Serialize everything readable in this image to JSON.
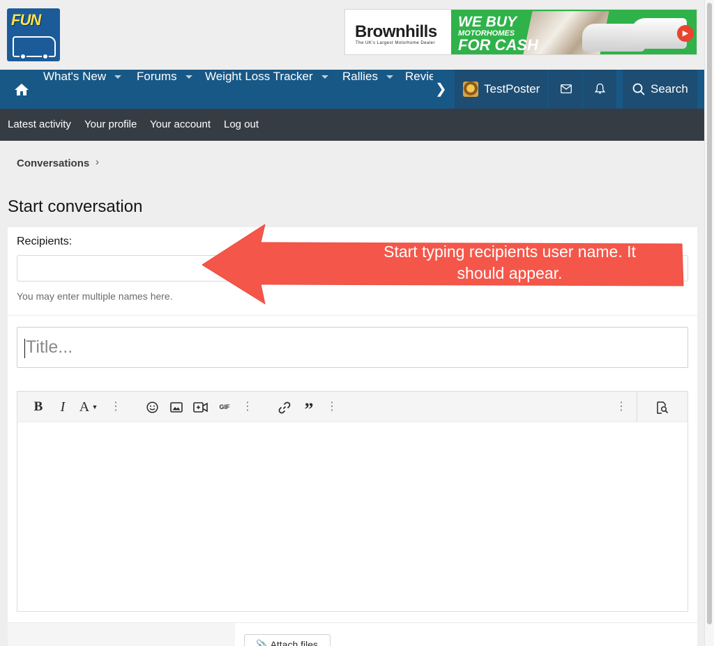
{
  "header": {
    "logo_text": "FUN",
    "banner": {
      "brand": "Brownhills",
      "tagline": "The UK's Largest Motorhome Dealer",
      "line1": "WE BUY",
      "line2": "MOTORHOMES",
      "line3": "FOR CASH"
    }
  },
  "nav": {
    "items": [
      {
        "label": "What's New"
      },
      {
        "label": "Forums"
      },
      {
        "label": "Weight Loss Tracker"
      },
      {
        "label": "Rallies"
      },
      {
        "label": "Revie"
      }
    ],
    "user": "TestPoster",
    "search_label": "Search"
  },
  "subnav": {
    "items": [
      {
        "label": "Latest activity"
      },
      {
        "label": "Your profile"
      },
      {
        "label": "Your account"
      },
      {
        "label": "Log out"
      }
    ]
  },
  "breadcrumb": {
    "label": "Conversations"
  },
  "page": {
    "title": "Start conversation"
  },
  "form": {
    "recipients_label": "Recipients:",
    "recipients_value": "",
    "recipients_hint": "You may enter multiple names here.",
    "title_placeholder": "Title...",
    "editor_toolbar": {
      "bold": "B",
      "italic": "I",
      "font": "A",
      "gif": "GIF"
    },
    "attach_label": "Attach files"
  },
  "annotation": {
    "line1": "Start typing recipients user name. It",
    "line2": "should appear.",
    "color": "#f4574a"
  },
  "colors": {
    "nav_bg": "#185886",
    "subnav_bg": "#353c43",
    "page_bg": "#eeeeee"
  }
}
